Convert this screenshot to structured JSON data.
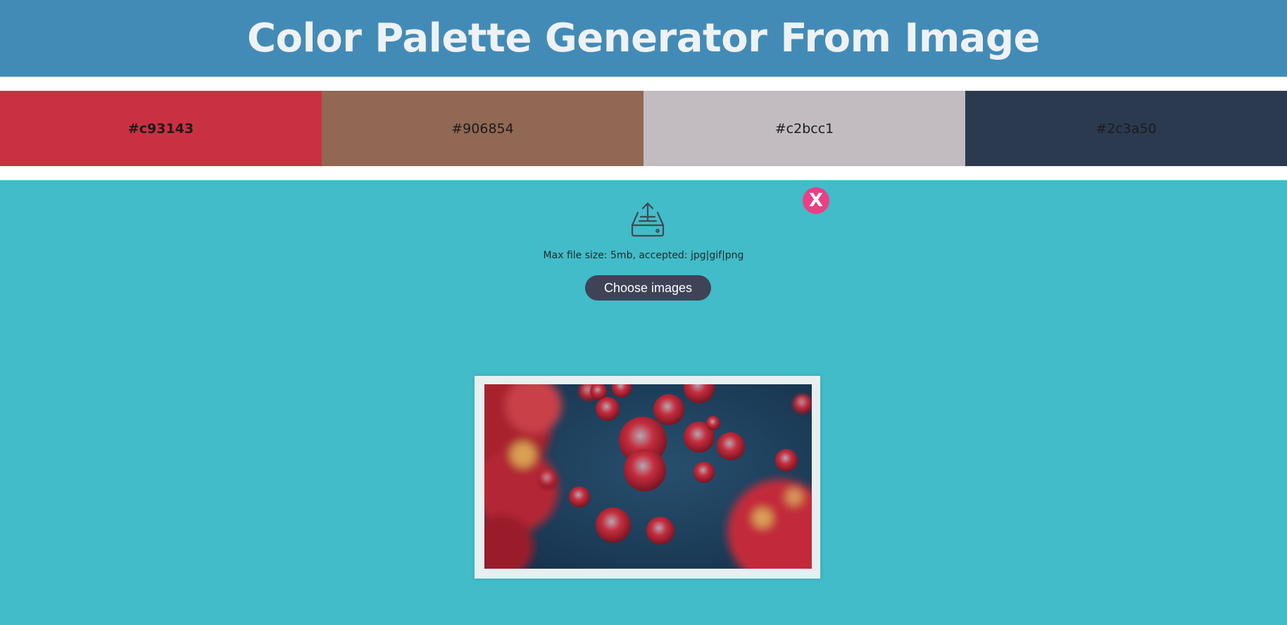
{
  "header": {
    "title": "Color Palette Generator From Image"
  },
  "palette": {
    "swatches": [
      {
        "hex": "#c93143",
        "label": "#c93143",
        "selected": true
      },
      {
        "hex": "#906854",
        "label": "#906854",
        "selected": false
      },
      {
        "hex": "#c2bcc1",
        "label": "#c2bcc1",
        "selected": false
      },
      {
        "hex": "#2c3a50",
        "label": "#2c3a50",
        "selected": false
      }
    ]
  },
  "upload": {
    "icon": "upload-tray-icon",
    "hint": "Max file size: 5mb, accepted: jpg|gif|png",
    "button_label": "Choose images"
  },
  "preview": {
    "remove_label": "X"
  },
  "colors": {
    "header_bg": "#438bb7",
    "upload_bg": "#42bcc8",
    "button_bg": "#3e4358",
    "remove_bg": "#ec3f86"
  }
}
